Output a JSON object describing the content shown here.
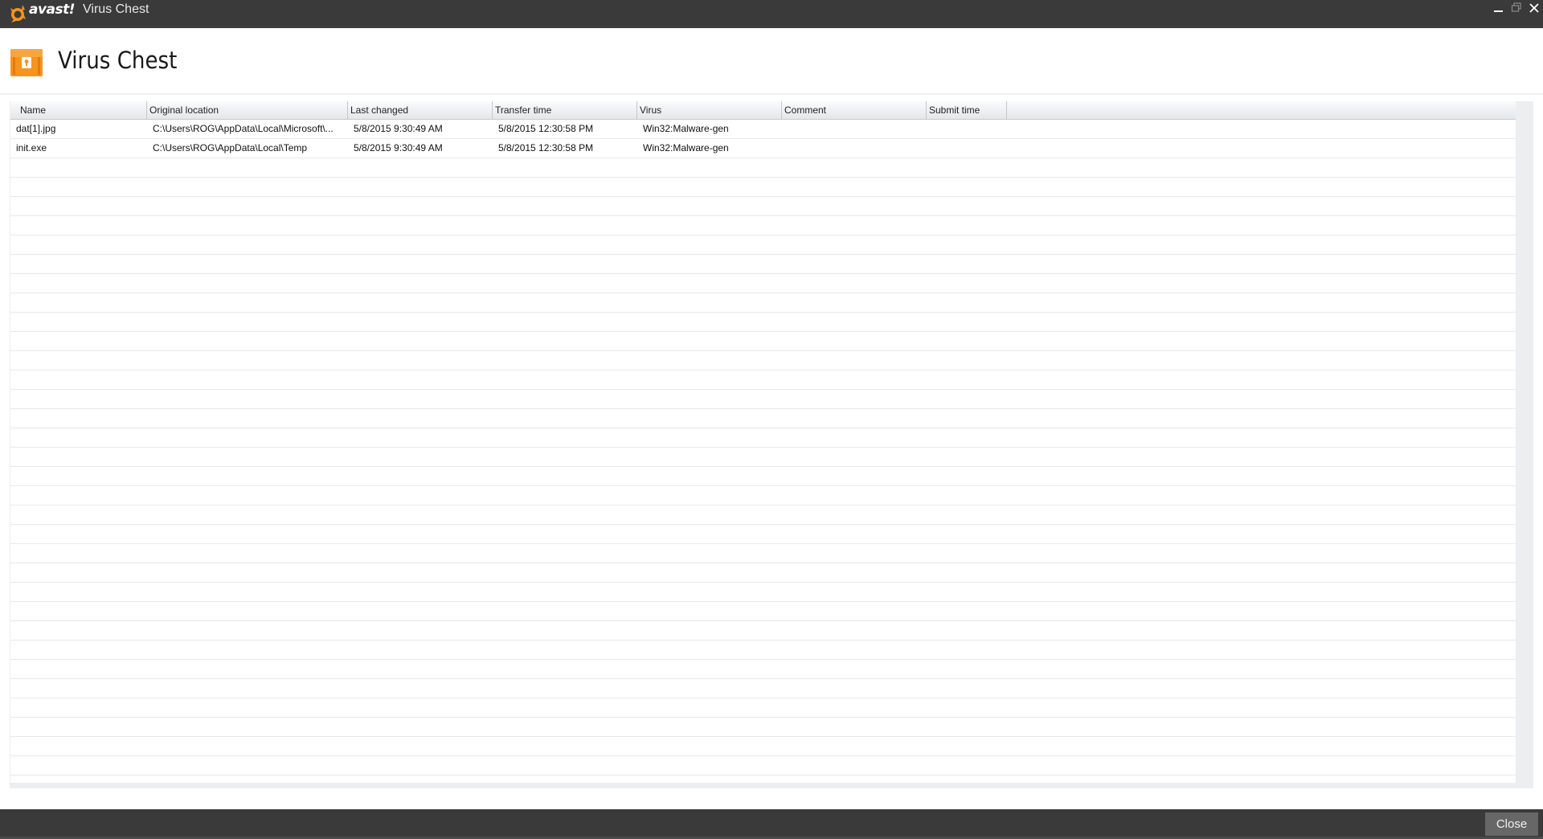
{
  "titlebar": {
    "brand": "avast!",
    "title": "Virus Chest"
  },
  "header": {
    "title": "Virus Chest"
  },
  "table": {
    "columns": [
      "Name",
      "Original location",
      "Last changed",
      "Transfer time",
      "Virus",
      "Comment",
      "Submit time"
    ],
    "rows": [
      {
        "name": "dat[1].jpg",
        "original_location": "C:\\Users\\ROG\\AppData\\Local\\Microsoft\\...",
        "last_changed": "5/8/2015 9:30:49 AM",
        "transfer_time": "5/8/2015 12:30:58 PM",
        "virus": "Win32:Malware-gen",
        "comment": "",
        "submit_time": ""
      },
      {
        "name": "init.exe",
        "original_location": "C:\\Users\\ROG\\AppData\\Local\\Temp",
        "last_changed": "5/8/2015 9:30:49 AM",
        "transfer_time": "5/8/2015 12:30:58 PM",
        "virus": "Win32:Malware-gen",
        "comment": "",
        "submit_time": ""
      }
    ]
  },
  "footer": {
    "close_label": "Close"
  },
  "colors": {
    "brand_orange": "#f7941d",
    "titlebar_bg": "#3a3a3a",
    "footer_bg": "#3a3a3a",
    "close_button_bg": "#676767"
  },
  "icons": {
    "brand": "avast-logo-icon",
    "header": "virus-chest-icon",
    "minimize": "minimize-icon",
    "restore": "restore-icon",
    "close": "close-icon"
  }
}
